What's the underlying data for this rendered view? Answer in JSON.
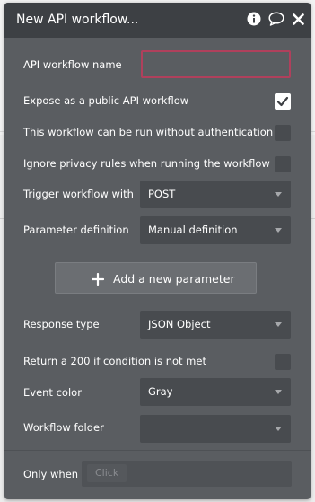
{
  "window": {
    "title": "New API workflow..."
  },
  "header_icons": [
    "info-icon",
    "comment-icon",
    "close-icon"
  ],
  "fields": {
    "api_workflow_name": {
      "label": "API workflow name",
      "value": ""
    },
    "expose_public": {
      "label": "Expose as a public API workflow",
      "checked": true
    },
    "run_without_auth": {
      "label": "This workflow can be run without authentication",
      "checked": false
    },
    "ignore_privacy": {
      "label": "Ignore privacy rules when running the workflow",
      "checked": false
    },
    "trigger_with": {
      "label": "Trigger workflow with",
      "value": "POST"
    },
    "parameter_definition": {
      "label": "Parameter definition",
      "value": "Manual definition"
    },
    "response_type": {
      "label": "Response type",
      "value": "JSON Object"
    },
    "return_200": {
      "label": "Return a 200 if condition is not met",
      "checked": false
    },
    "event_color": {
      "label": "Event color",
      "value": "Gray"
    },
    "workflow_folder": {
      "label": "Workflow folder",
      "value": ""
    },
    "only_when": {
      "label": "Only when",
      "placeholder": "Click"
    }
  },
  "add_parameter": {
    "label": "Add a new parameter"
  },
  "colors": {
    "panel_bg": "#5a5d61",
    "header_bg": "#3d4044",
    "input_bg": "#484b4f",
    "focus_border": "#b0405c"
  }
}
